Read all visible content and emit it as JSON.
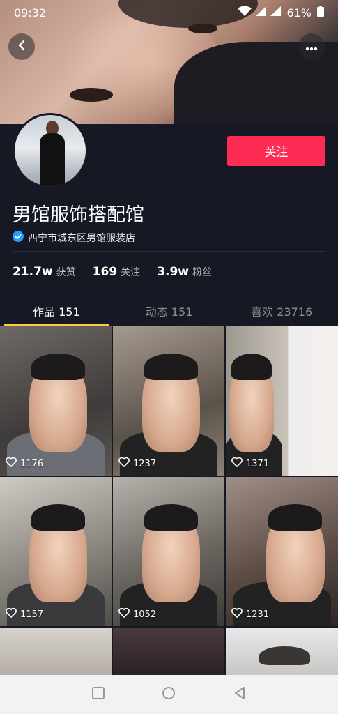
{
  "status_bar": {
    "time": "09:32",
    "battery": "61%"
  },
  "profile": {
    "name": "男馆服饰搭配馆",
    "verified_text": "西宁市城东区男馆服装店",
    "follow_label": "关注"
  },
  "stats": [
    {
      "value": "21.7w",
      "label": "获赞"
    },
    {
      "value": "169",
      "label": "关注"
    },
    {
      "value": "3.9w",
      "label": "粉丝"
    }
  ],
  "tabs": [
    {
      "label": "作品 151",
      "active": true
    },
    {
      "label": "动态 151",
      "active": false
    },
    {
      "label": "喜欢 23716",
      "active": false
    }
  ],
  "videos": [
    {
      "likes": "1176"
    },
    {
      "likes": "1237"
    },
    {
      "likes": "1371"
    },
    {
      "likes": "1157"
    },
    {
      "likes": "1052"
    },
    {
      "likes": "1231"
    }
  ],
  "colors": {
    "background": "#161823",
    "accent": "#fe2c55",
    "tab_indicator": "#facd3a",
    "verified": "#20a0ff"
  },
  "icons": [
    "back-arrow-icon",
    "more-dots-icon",
    "verified-check-icon",
    "heart-icon",
    "wifi-icon",
    "signal-icon",
    "battery-icon",
    "nav-square-icon",
    "nav-circle-icon",
    "nav-triangle-icon"
  ]
}
